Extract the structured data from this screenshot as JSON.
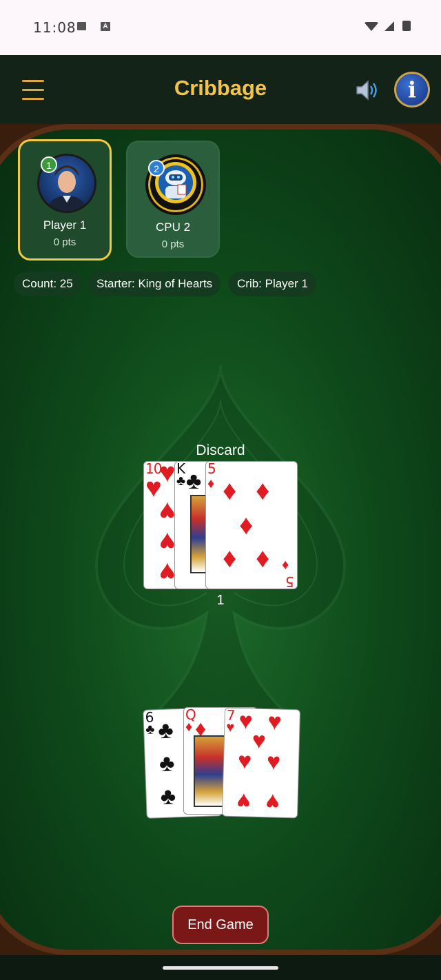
{
  "status_bar": {
    "time": "11:08"
  },
  "header": {
    "title": "Cribbage"
  },
  "players": [
    {
      "name": "Player 1",
      "points": "0 pts",
      "badge": "1"
    },
    {
      "name": "CPU 2",
      "points": "0 pts",
      "badge": "2"
    }
  ],
  "info_chips": {
    "count": "Count: 25",
    "starter": "Starter: King of Hearts",
    "crib": "Crib: Player 1"
  },
  "play_area": {
    "label": "Discard",
    "count": "1",
    "cards": [
      {
        "rank": "10",
        "suit": "hearts"
      },
      {
        "rank": "K",
        "suit": "clubs"
      },
      {
        "rank": "5",
        "suit": "diamonds"
      }
    ]
  },
  "hand": {
    "cards": [
      {
        "rank": "6",
        "suit": "clubs"
      },
      {
        "rank": "Q",
        "suit": "diamonds"
      },
      {
        "rank": "7",
        "suit": "hearts"
      }
    ]
  },
  "actions": {
    "end_game": "End Game"
  },
  "colors": {
    "accent": "#f2c44c",
    "felt": "#0f4a1b",
    "danger": "#7a1818"
  }
}
